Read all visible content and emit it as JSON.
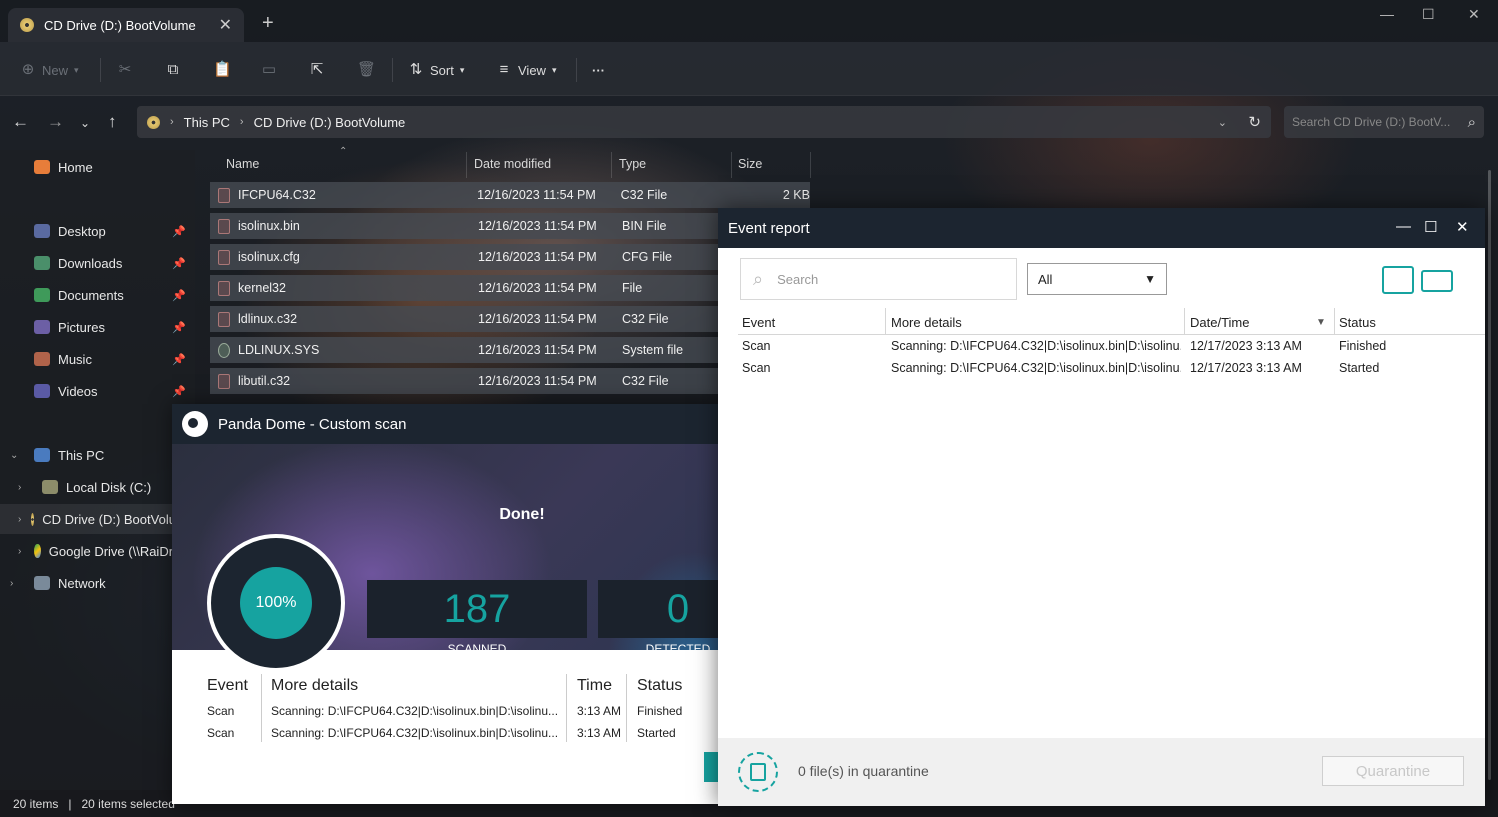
{
  "window": {
    "tab_title": "CD Drive (D:) BootVolume",
    "new_tab": "+",
    "minimize": "—",
    "maximize": "☐",
    "close": "✕"
  },
  "toolbar": {
    "new_label": "New",
    "sort_label": "Sort",
    "view_label": "View",
    "more_label": "···"
  },
  "address": {
    "crumbs": [
      "This PC",
      "CD Drive (D:) BootVolume"
    ],
    "search_placeholder": "Search CD Drive (D:) BootV..."
  },
  "sidebar": {
    "home": "Home",
    "quick": [
      "Desktop",
      "Downloads",
      "Documents",
      "Pictures",
      "Music",
      "Videos"
    ],
    "this_pc": "This PC",
    "drives": [
      "Local Disk (C:)",
      "CD Drive (D:) BootVolume",
      "Google Drive (\\\\RaiDrive)"
    ],
    "network": "Network"
  },
  "files": {
    "columns": [
      "Name",
      "Date modified",
      "Type",
      "Size"
    ],
    "rows": [
      {
        "name": "IFCPU64.C32",
        "date": "12/16/2023 11:54 PM",
        "type": "C32 File",
        "size": "2 KB"
      },
      {
        "name": "isolinux.bin",
        "date": "12/16/2023 11:54 PM",
        "type": "BIN File",
        "size": ""
      },
      {
        "name": "isolinux.cfg",
        "date": "12/16/2023 11:54 PM",
        "type": "CFG File",
        "size": ""
      },
      {
        "name": "kernel32",
        "date": "12/16/2023 11:54 PM",
        "type": "File",
        "size": ""
      },
      {
        "name": "ldlinux.c32",
        "date": "12/16/2023 11:54 PM",
        "type": "C32 File",
        "size": ""
      },
      {
        "name": "LDLINUX.SYS",
        "date": "12/16/2023 11:54 PM",
        "type": "System file",
        "size": ""
      },
      {
        "name": "libutil.c32",
        "date": "12/16/2023 11:54 PM",
        "type": "C32 File",
        "size": ""
      }
    ]
  },
  "statusbar": {
    "items": "20 items",
    "sep": "|",
    "selected": "20 items selected"
  },
  "panda": {
    "title": "Panda Dome - Custom scan",
    "done": "Done!",
    "progress": "100%",
    "scanned_value": "187",
    "scanned_label": "SCANNED",
    "detected_value": "0",
    "detected_label": "DETECTED",
    "table": {
      "headers": [
        "Event",
        "More details",
        "Time",
        "Status"
      ],
      "rows": [
        {
          "event": "Scan",
          "details": "Scanning: D:\\IFCPU64.C32|D:\\isolinux.bin|D:\\isolinu...",
          "time": "3:13 AM",
          "status": "Finished"
        },
        {
          "event": "Scan",
          "details": "Scanning: D:\\IFCPU64.C32|D:\\isolinux.bin|D:\\isolinu...",
          "time": "3:13 AM",
          "status": "Started"
        }
      ]
    }
  },
  "event_report": {
    "title": "Event report",
    "search_placeholder": "Search",
    "filter_value": "All",
    "headers": [
      "Event",
      "More details",
      "Date/Time",
      "Status"
    ],
    "rows": [
      {
        "event": "Scan",
        "details": "Scanning: D:\\IFCPU64.C32|D:\\isolinux.bin|D:\\isolinu...",
        "datetime": "12/17/2023 3:13 AM",
        "status": "Finished"
      },
      {
        "event": "Scan",
        "details": "Scanning: D:\\IFCPU64.C32|D:\\isolinux.bin|D:\\isolinu...",
        "datetime": "12/17/2023 3:13 AM",
        "status": "Started"
      }
    ],
    "quarantine_text": "0 file(s) in quarantine",
    "quarantine_button": "Quarantine"
  },
  "colors": {
    "accent": "#16a3a0",
    "title_bar": "#1c2530"
  }
}
